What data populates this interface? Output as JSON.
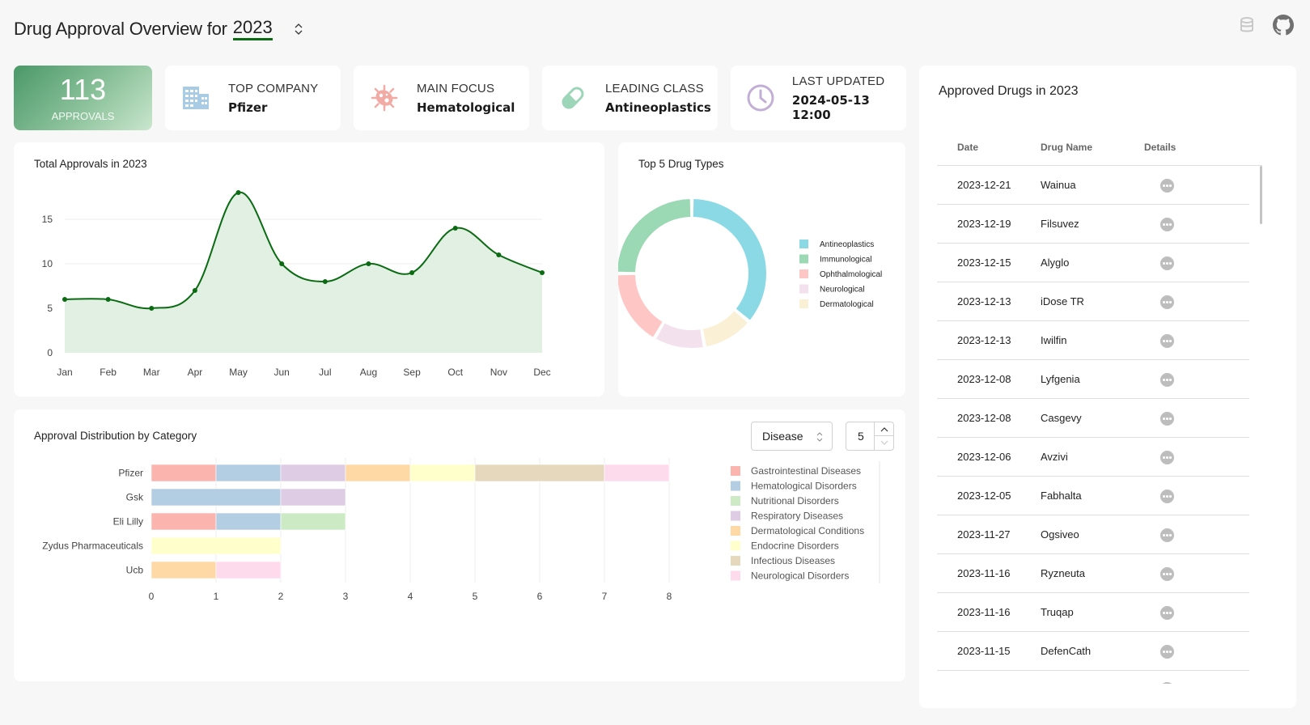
{
  "header": {
    "title": "Drug Approval Overview for",
    "year": "2023"
  },
  "top_icons": [
    "database-icon",
    "github-icon"
  ],
  "stats": {
    "approvals": {
      "value": "113",
      "label": "APPROVALS"
    },
    "top_company": {
      "label": "TOP COMPANY",
      "value": "Pfizer",
      "icon": "building-icon",
      "color": "#a9cce6"
    },
    "main_focus": {
      "label": "MAIN FOCUS",
      "value": "Hematological",
      "icon": "bacteria-icon",
      "color": "#f2aba4"
    },
    "leading_class": {
      "label": "LEADING CLASS",
      "value": "Antineoplastics",
      "icon": "pill-icon",
      "color": "#9dd5b8"
    },
    "last_updated": {
      "label": "LAST UPDATED",
      "value": "2024-05-13 12:00",
      "icon": "clock-icon",
      "color": "#c3afd6"
    }
  },
  "chart_data": [
    {
      "type": "area",
      "title": "Total Approvals in 2023",
      "categories": [
        "Jan",
        "Feb",
        "Mar",
        "Apr",
        "May",
        "Jun",
        "Jul",
        "Aug",
        "Sep",
        "Oct",
        "Nov",
        "Dec"
      ],
      "values": [
        6,
        6,
        5,
        7,
        18,
        10,
        8,
        10,
        9,
        14,
        11,
        9
      ],
      "yticks": [
        0,
        5,
        10,
        15
      ],
      "ylim": [
        0,
        20
      ],
      "xlabel": "",
      "ylabel": "",
      "grid": true,
      "line_color": "#0a6b12",
      "fill_color": "#e2efe3"
    },
    {
      "type": "pie",
      "title": "Top 5 Drug Types",
      "donut": true,
      "legend": "right",
      "labels": [
        "Antineoplastics",
        "Immunological",
        "Ophthalmological",
        "Neurological",
        "Dermatological"
      ],
      "values": [
        13,
        9,
        6,
        4,
        4
      ],
      "colors": [
        "#8ad9e5",
        "#9bd8b4",
        "#ffc6c6",
        "#f3e1ee",
        "#faf0d6"
      ],
      "order_clockwise": [
        "Antineoplastics",
        "Dermatological",
        "Neurological",
        "Ophthalmological",
        "Immunological"
      ]
    },
    {
      "type": "bar",
      "orientation": "horizontal",
      "stacked": true,
      "title": "Approval Distribution by Category",
      "categories": [
        "Pfizer",
        "Gsk",
        "Eli Lilly",
        "Zydus Pharmaceuticals",
        "Ucb"
      ],
      "xticks": [
        0,
        1,
        2,
        3,
        4,
        5,
        6,
        7,
        8
      ],
      "xlim": [
        0,
        8
      ],
      "legend": "right",
      "series": [
        {
          "name": "Gastrointestinal Diseases",
          "color": "#fbb4ae",
          "values": [
            1,
            0,
            1,
            0,
            0
          ]
        },
        {
          "name": "Hematological Disorders",
          "color": "#b3cde3",
          "values": [
            1,
            2,
            1,
            0,
            0
          ]
        },
        {
          "name": "Nutritional Disorders",
          "color": "#ccebc5",
          "values": [
            0,
            0,
            1,
            0,
            0
          ]
        },
        {
          "name": "Respiratory Diseases",
          "color": "#decbe4",
          "values": [
            1,
            1,
            0,
            0,
            0
          ]
        },
        {
          "name": "Dermatological Conditions",
          "color": "#fed9a6",
          "values": [
            1,
            0,
            0,
            0,
            1
          ]
        },
        {
          "name": "Endocrine Disorders",
          "color": "#ffffcc",
          "values": [
            1,
            0,
            0,
            2,
            0
          ]
        },
        {
          "name": "Infectious Diseases",
          "color": "#e5d8bd",
          "values": [
            2,
            0,
            0,
            0,
            0
          ]
        },
        {
          "name": "Neurological Disorders",
          "color": "#fddaec",
          "values": [
            1,
            0,
            0,
            0,
            1
          ]
        }
      ]
    }
  ],
  "bar_controls": {
    "group_by": "Disease",
    "top_n": "5"
  },
  "table": {
    "title": "Approved Drugs in 2023",
    "columns": [
      "Date",
      "Drug Name",
      "Details"
    ],
    "rows": [
      {
        "date": "2023-12-21",
        "name": "Wainua"
      },
      {
        "date": "2023-12-19",
        "name": "Filsuvez"
      },
      {
        "date": "2023-12-15",
        "name": "Alyglo"
      },
      {
        "date": "2023-12-13",
        "name": "iDose TR"
      },
      {
        "date": "2023-12-13",
        "name": "Iwilfin"
      },
      {
        "date": "2023-12-08",
        "name": "Lyfgenia"
      },
      {
        "date": "2023-12-08",
        "name": "Casgevy"
      },
      {
        "date": "2023-12-06",
        "name": "Avzivi"
      },
      {
        "date": "2023-12-05",
        "name": "Fabhalta"
      },
      {
        "date": "2023-11-27",
        "name": "Ogsiveo"
      },
      {
        "date": "2023-11-16",
        "name": "Ryzneuta"
      },
      {
        "date": "2023-11-16",
        "name": "Truqap"
      },
      {
        "date": "2023-11-15",
        "name": "DefenCath"
      }
    ]
  }
}
